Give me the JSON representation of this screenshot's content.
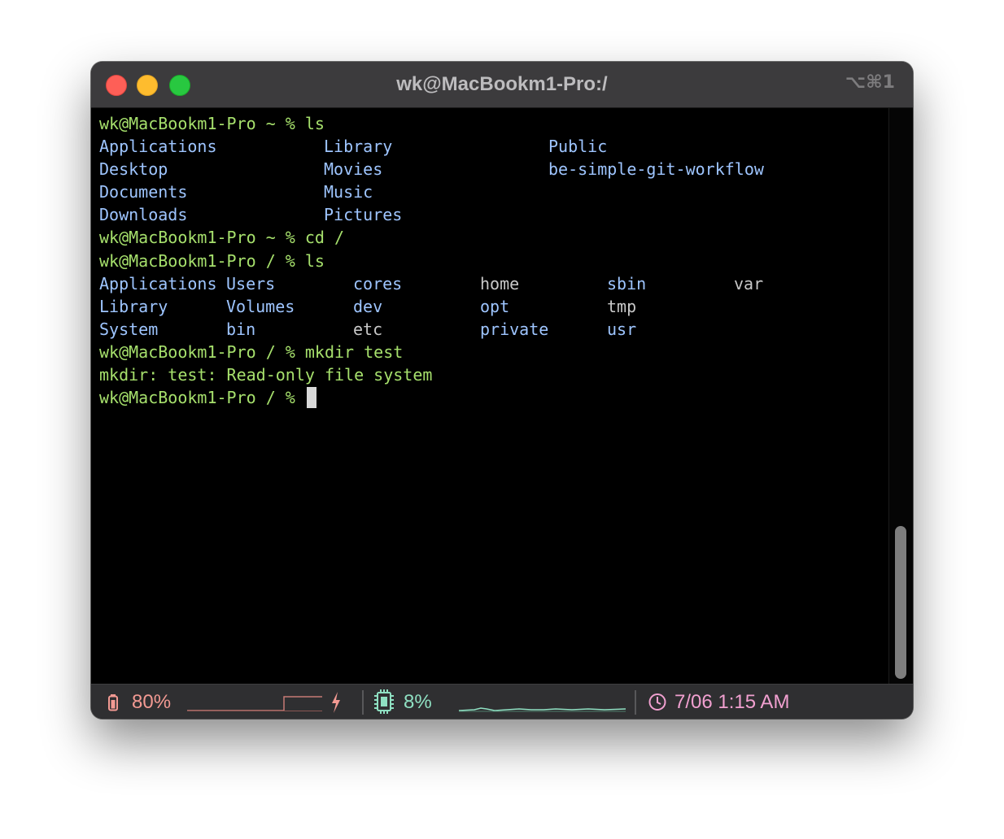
{
  "window": {
    "title": "wk@MacBookm1-Pro:/",
    "shortcut": "⌥⌘1",
    "traffic_lights": {
      "close": "#fe5f57",
      "minimize": "#febc2e",
      "zoom": "#28c840"
    }
  },
  "terminal": {
    "prompt_home": "wk@MacBookm1-Pro ~ % ",
    "prompt_root": "wk@MacBookm1-Pro / % ",
    "cmd_ls_1": "ls",
    "ls_home": [
      [
        "Applications",
        "Library",
        "Public"
      ],
      [
        "Desktop",
        "Movies",
        "be-simple-git-workflow"
      ],
      [
        "Documents",
        "Music",
        ""
      ],
      [
        "Downloads",
        "Pictures",
        ""
      ]
    ],
    "cmd_cd": "cd /",
    "cmd_ls_2": "ls",
    "ls_root": [
      [
        "Applications",
        "Users",
        "cores",
        "home",
        "sbin",
        "var"
      ],
      [
        "Library",
        "Volumes",
        "dev",
        "opt",
        "tmp",
        ""
      ],
      [
        "System",
        "bin",
        "etc",
        "private",
        "usr",
        ""
      ]
    ],
    "cmd_mkdir": "mkdir test",
    "error": "mkdir: test: Read-only file system",
    "colors": {
      "prompt": "#a6e06c",
      "directory": "#9ec5ff",
      "file": "#c8c8c8"
    }
  },
  "statusbar": {
    "battery_icon": "battery-icon",
    "battery": "80%",
    "charging_icon": "bolt-icon",
    "cpu_icon": "cpu-chip-icon",
    "cpu": "8%",
    "clock_icon": "clock-icon",
    "datetime": "7/06 1:15 AM",
    "colors": {
      "battery": "#f39a93",
      "cpu": "#8fe0c2",
      "clock": "#f1a0d0"
    }
  }
}
